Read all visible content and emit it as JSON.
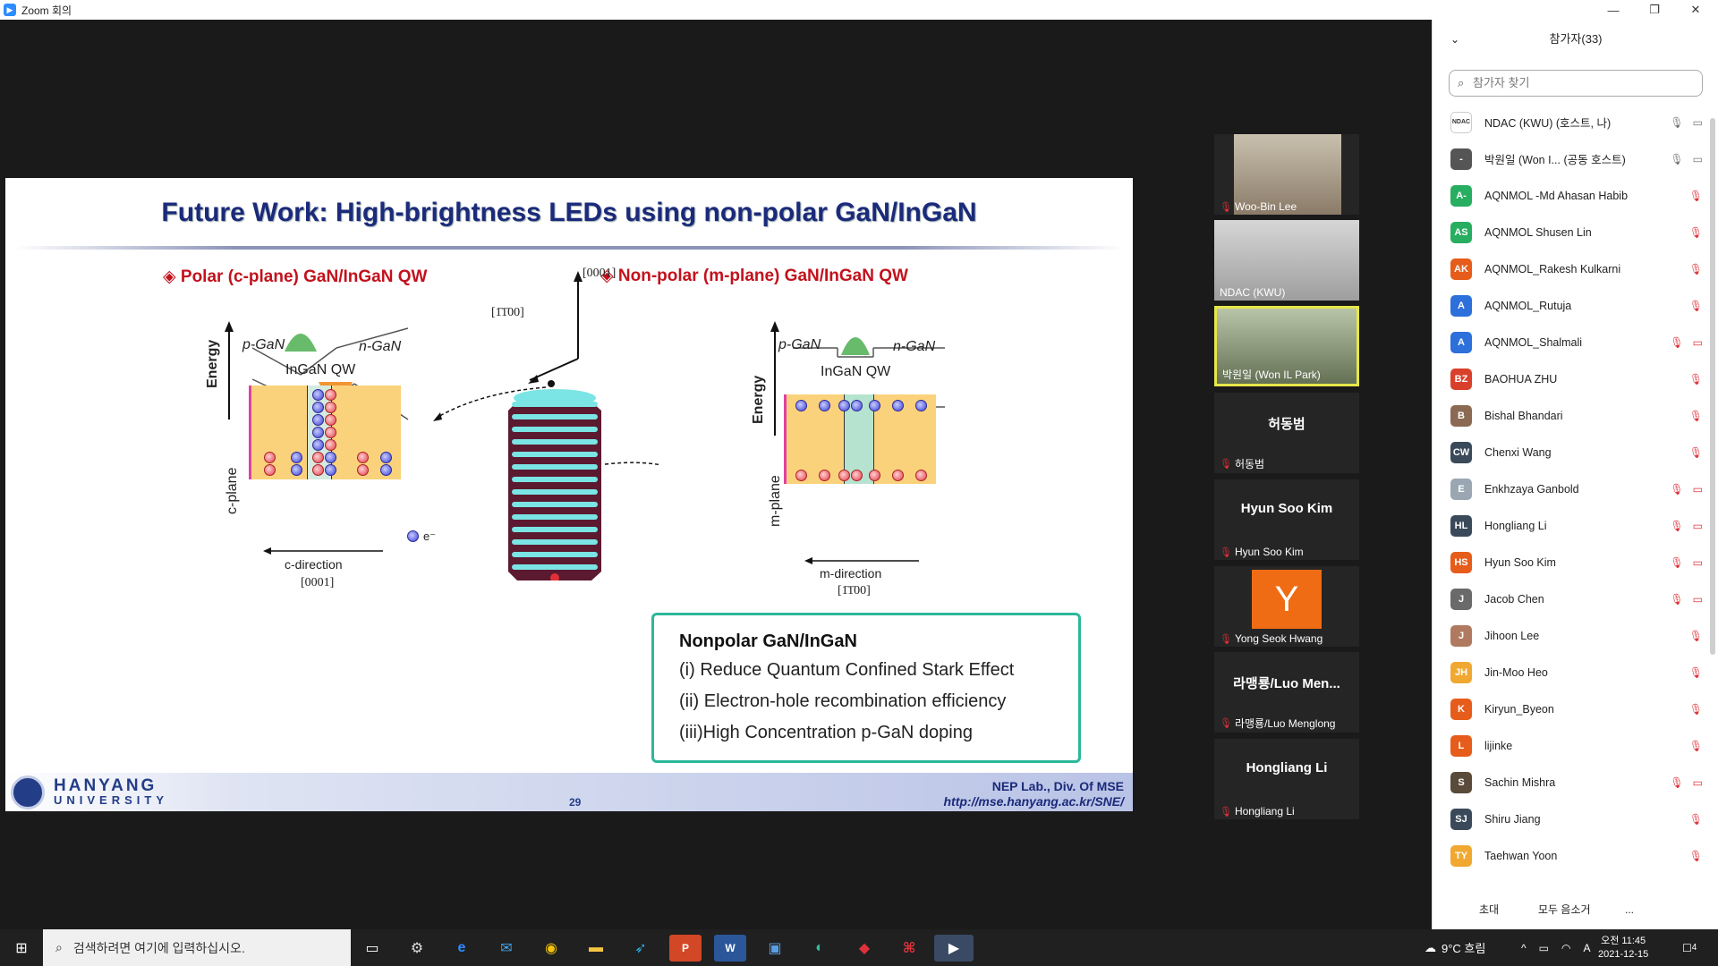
{
  "window": {
    "title": "Zoom 회의",
    "minimize": "—",
    "restore": "❐",
    "close": "✕"
  },
  "slide": {
    "title": "Future Work: High-brightness LEDs using non-polar GaN/InGaN",
    "polar_heading": "◈ Polar (c-plane) GaN/InGaN QW",
    "nonpolar_heading": "◈ Non-polar (m-plane) GaN/InGaN QW",
    "energy": "Energy",
    "p_gan": "p-GaN",
    "n_gan": "n-GaN",
    "ingan_qw": "InGaN QW",
    "c_plane": "c-plane",
    "m_plane": "m-plane",
    "c_direction": "c-direction",
    "c_index": "[0001]",
    "m_direction": "m-direction",
    "m_index": "[1̄1̄00]",
    "dir_0001": "[0001]",
    "dir_1100": "[1̄1̄00]",
    "electron": "e⁻",
    "box_heading": "Nonpolar GaN/InGaN",
    "box_lines": [
      "(i)  Reduce Quantum Confined Stark Effect",
      "(ii) Electron-hole recombination efficiency",
      "(iii)High Concentration p-GaN doping"
    ],
    "university": "HANYANG",
    "university_sub": "UNIVERSITY",
    "page_number": "29",
    "lab": "NEP Lab., Div. Of MSE",
    "url": "http://mse.hanyang.ac.kr/SNE/"
  },
  "video_tiles": [
    {
      "name": "Woo-Bin Lee",
      "type": "video"
    },
    {
      "name": "NDAC (KWU)",
      "type": "video"
    },
    {
      "name": "박원일 (Won IL Park)",
      "type": "video"
    },
    {
      "big": "허동범",
      "name": "허동범",
      "type": "name"
    },
    {
      "big": "Hyun Soo Kim",
      "name": "Hyun Soo Kim",
      "type": "name"
    },
    {
      "avatar": "Y",
      "name": "Yong Seok Hwang",
      "type": "avatar"
    },
    {
      "big": "라맹룡/Luo Men...",
      "name": "라맹룡/Luo Menglong",
      "type": "name"
    },
    {
      "big": "Hongliang Li",
      "name": "Hongliang Li",
      "type": "name"
    }
  ],
  "panel": {
    "title": "참가자(33)",
    "search_placeholder": "참가자 찾기",
    "participants": [
      {
        "initials": "NDAC",
        "color": "#ffffff",
        "text": "#333",
        "name": "NDAC (KWU) (호스트, 나)",
        "mic": "on",
        "cam": "on"
      },
      {
        "initials": "-",
        "color": "#555",
        "name": "박원일 (Won I... (공동 호스트)",
        "mic": "on",
        "cam": "on"
      },
      {
        "initials": "A-",
        "color": "#27ae60",
        "name": "AQNMOL -Md Ahasan Habib",
        "mic": "off"
      },
      {
        "initials": "AS",
        "color": "#27ae60",
        "name": "AQNMOL Shusen Lin",
        "mic": "off"
      },
      {
        "initials": "AK",
        "color": "#e65c1a",
        "name": "AQNMOL_Rakesh Kulkarni",
        "mic": "off"
      },
      {
        "initials": "A",
        "color": "#2d6fdb",
        "name": "AQNMOL_Rutuja",
        "mic": "off"
      },
      {
        "initials": "A",
        "color": "#2d6fdb",
        "name": "AQNMOL_Shalmali",
        "mic": "off",
        "cam": "off"
      },
      {
        "initials": "BZ",
        "color": "#d9402b",
        "name": "BAOHUA ZHU",
        "mic": "off"
      },
      {
        "initials": "B",
        "color": "#8a6a52",
        "name": "Bishal Bhandari",
        "mic": "off"
      },
      {
        "initials": "CW",
        "color": "#3b4a5a",
        "name": "Chenxi Wang",
        "mic": "off"
      },
      {
        "initials": "E",
        "color": "#9aa7b3",
        "name": "Enkhzaya Ganbold",
        "mic": "off",
        "cam": "off"
      },
      {
        "initials": "HL",
        "color": "#3b4a5a",
        "name": "Hongliang Li",
        "mic": "off",
        "cam": "off"
      },
      {
        "initials": "HS",
        "color": "#e65c1a",
        "name": "Hyun Soo Kim",
        "mic": "off",
        "cam": "off"
      },
      {
        "initials": "J",
        "color": "#6a6a6a",
        "name": "Jacob Chen",
        "mic": "off",
        "cam": "off"
      },
      {
        "initials": "J",
        "color": "#b07a60",
        "name": "Jihoon Lee",
        "mic": "off"
      },
      {
        "initials": "JH",
        "color": "#f0a830",
        "name": "Jin-Moo Heo",
        "mic": "off"
      },
      {
        "initials": "K",
        "color": "#e65c1a",
        "name": "Kiryun_Byeon",
        "mic": "off"
      },
      {
        "initials": "L",
        "color": "#e65c1a",
        "name": "lijinke",
        "mic": "off"
      },
      {
        "initials": "S",
        "color": "#5a4a3a",
        "name": "Sachin Mishra",
        "mic": "off",
        "cam": "off"
      },
      {
        "initials": "SJ",
        "color": "#3b4a5a",
        "name": "Shiru Jiang",
        "mic": "off"
      },
      {
        "initials": "TY",
        "color": "#f0a830",
        "name": "Taehwan Yoon",
        "mic": "off"
      }
    ],
    "invite": "초대",
    "mute_all": "모두 음소거",
    "more": "..."
  },
  "taskbar": {
    "search_placeholder": "검색하려면 여기에 입력하십시오.",
    "weather": "9°C 흐림",
    "ime": "A",
    "time": "오전 11:45",
    "date": "2021-12-15",
    "notif": "4"
  }
}
